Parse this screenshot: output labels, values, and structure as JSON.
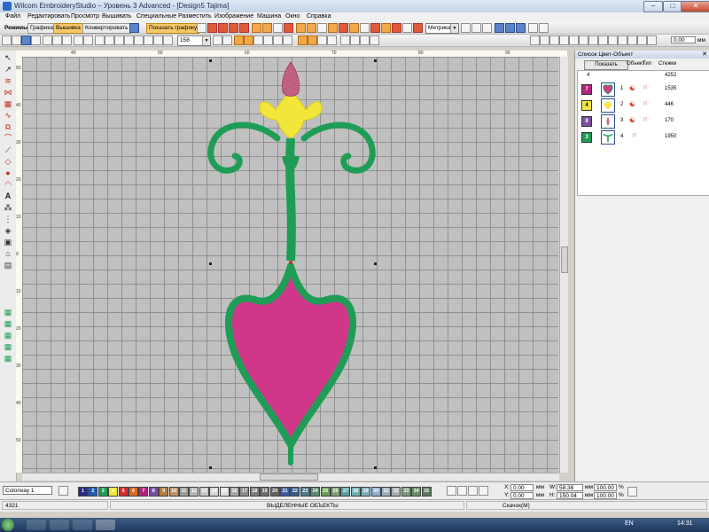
{
  "window": {
    "title": "Wilcom EmbroideryStudio – Уровень 3 Advanced - [Design5    Tajima]"
  },
  "menu": [
    "Файл",
    "Редактировать",
    "Просмотр",
    "Вышивать",
    "Специальные",
    "Разместить",
    "Изображение",
    "Машина",
    "Окно",
    "Справка"
  ],
  "toolbar": {
    "mode_label": "Режимы:",
    "graphics": "Графика",
    "embroidery": "Вышивка",
    "convert": "Конвертировать",
    "show_graphics": "Показать графику",
    "units": "Метрика",
    "zoom": "158",
    "size_value": "0.00",
    "size_unit": "мм"
  },
  "ruler": {
    "h_ticks": [
      "40",
      "50",
      "60",
      "70",
      "80",
      "90"
    ],
    "v_ticks": [
      "50",
      "40",
      "30",
      "20",
      "10",
      "0",
      "10",
      "20",
      "30",
      "40",
      "50"
    ]
  },
  "panel": {
    "title": "Список Цвет-Объект",
    "show_button": "Показать",
    "col_objects": "Объект",
    "col_type": "Тип",
    "col_stitches": "Стежки",
    "summary_objects": "4",
    "summary_stitches": "4252",
    "rows": [
      {
        "color_num": "7",
        "obj": "1",
        "stitches": "1535",
        "color": "#b0257a"
      },
      {
        "color_num": "4",
        "obj": "2",
        "stitches": "446",
        "color": "#f2e63a"
      },
      {
        "color_num": "8",
        "obj": "3",
        "stitches": "170",
        "color": "#7a4ea0"
      },
      {
        "color_num": "3",
        "obj": "4",
        "stitches": "1950",
        "color": "#1f9d56"
      }
    ]
  },
  "colorway": {
    "name": "Colorway 1"
  },
  "palette": [
    {
      "n": "1",
      "c": "#2a2a8a"
    },
    {
      "n": "2",
      "c": "#1a5fb4"
    },
    {
      "n": "3",
      "c": "#1f9d56"
    },
    {
      "n": "4",
      "c": "#f2e63a"
    },
    {
      "n": "5",
      "c": "#d92b2b"
    },
    {
      "n": "6",
      "c": "#e06a1e"
    },
    {
      "n": "7",
      "c": "#b0257a"
    },
    {
      "n": "8",
      "c": "#7a4ea0"
    },
    {
      "n": "9",
      "c": "#b87c3c"
    },
    {
      "n": "10",
      "c": "#c09060"
    },
    {
      "n": "11",
      "c": "#9c9c9c"
    },
    {
      "n": "12",
      "c": "#b5b5b5"
    },
    {
      "n": "13",
      "c": "#c8c8c8"
    },
    {
      "n": "14",
      "c": "#d6d6d6"
    },
    {
      "n": "15",
      "c": "#e0e0e0"
    },
    {
      "n": "16",
      "c": "#a6a6a6"
    },
    {
      "n": "17",
      "c": "#8a8a8a"
    },
    {
      "n": "18",
      "c": "#7c7c7c"
    },
    {
      "n": "19",
      "c": "#6e6e6e"
    },
    {
      "n": "20",
      "c": "#606060"
    },
    {
      "n": "21",
      "c": "#3a5ca8"
    },
    {
      "n": "22",
      "c": "#345c8c"
    },
    {
      "n": "23",
      "c": "#4a7a8a"
    },
    {
      "n": "24",
      "c": "#5a8a6a"
    },
    {
      "n": "25",
      "c": "#6a9a5a"
    },
    {
      "n": "26",
      "c": "#7aa07a"
    },
    {
      "n": "27",
      "c": "#5aa0a0"
    },
    {
      "n": "28",
      "c": "#6ab0b0"
    },
    {
      "n": "29",
      "c": "#7ab0c0"
    },
    {
      "n": "30",
      "c": "#8ab0d0"
    },
    {
      "n": "31",
      "c": "#9ab0c0"
    },
    {
      "n": "32",
      "c": "#aab0b0"
    },
    {
      "n": "33",
      "c": "#7a9a7a"
    },
    {
      "n": "34",
      "c": "#6a8a6a"
    },
    {
      "n": "35",
      "c": "#5a7a5a"
    }
  ],
  "coords": {
    "x_label": "X:",
    "x_val": "0.00",
    "y_label": "Y:",
    "y_val": "0.00",
    "w_label": "W:",
    "w_val": "58.38",
    "h_label": "H:",
    "h_val": "150.04",
    "unit": "мм",
    "pct1": "100.00",
    "pct2": "100.00",
    "pct_unit": "%"
  },
  "status": {
    "count": "4321",
    "selected": "ВЫДЕЛЕННЫЕ ОБЪЕКТЫ",
    "hint": "Скачок(M)"
  },
  "taskbar": {
    "lang": "EN",
    "clock": "14:31"
  }
}
